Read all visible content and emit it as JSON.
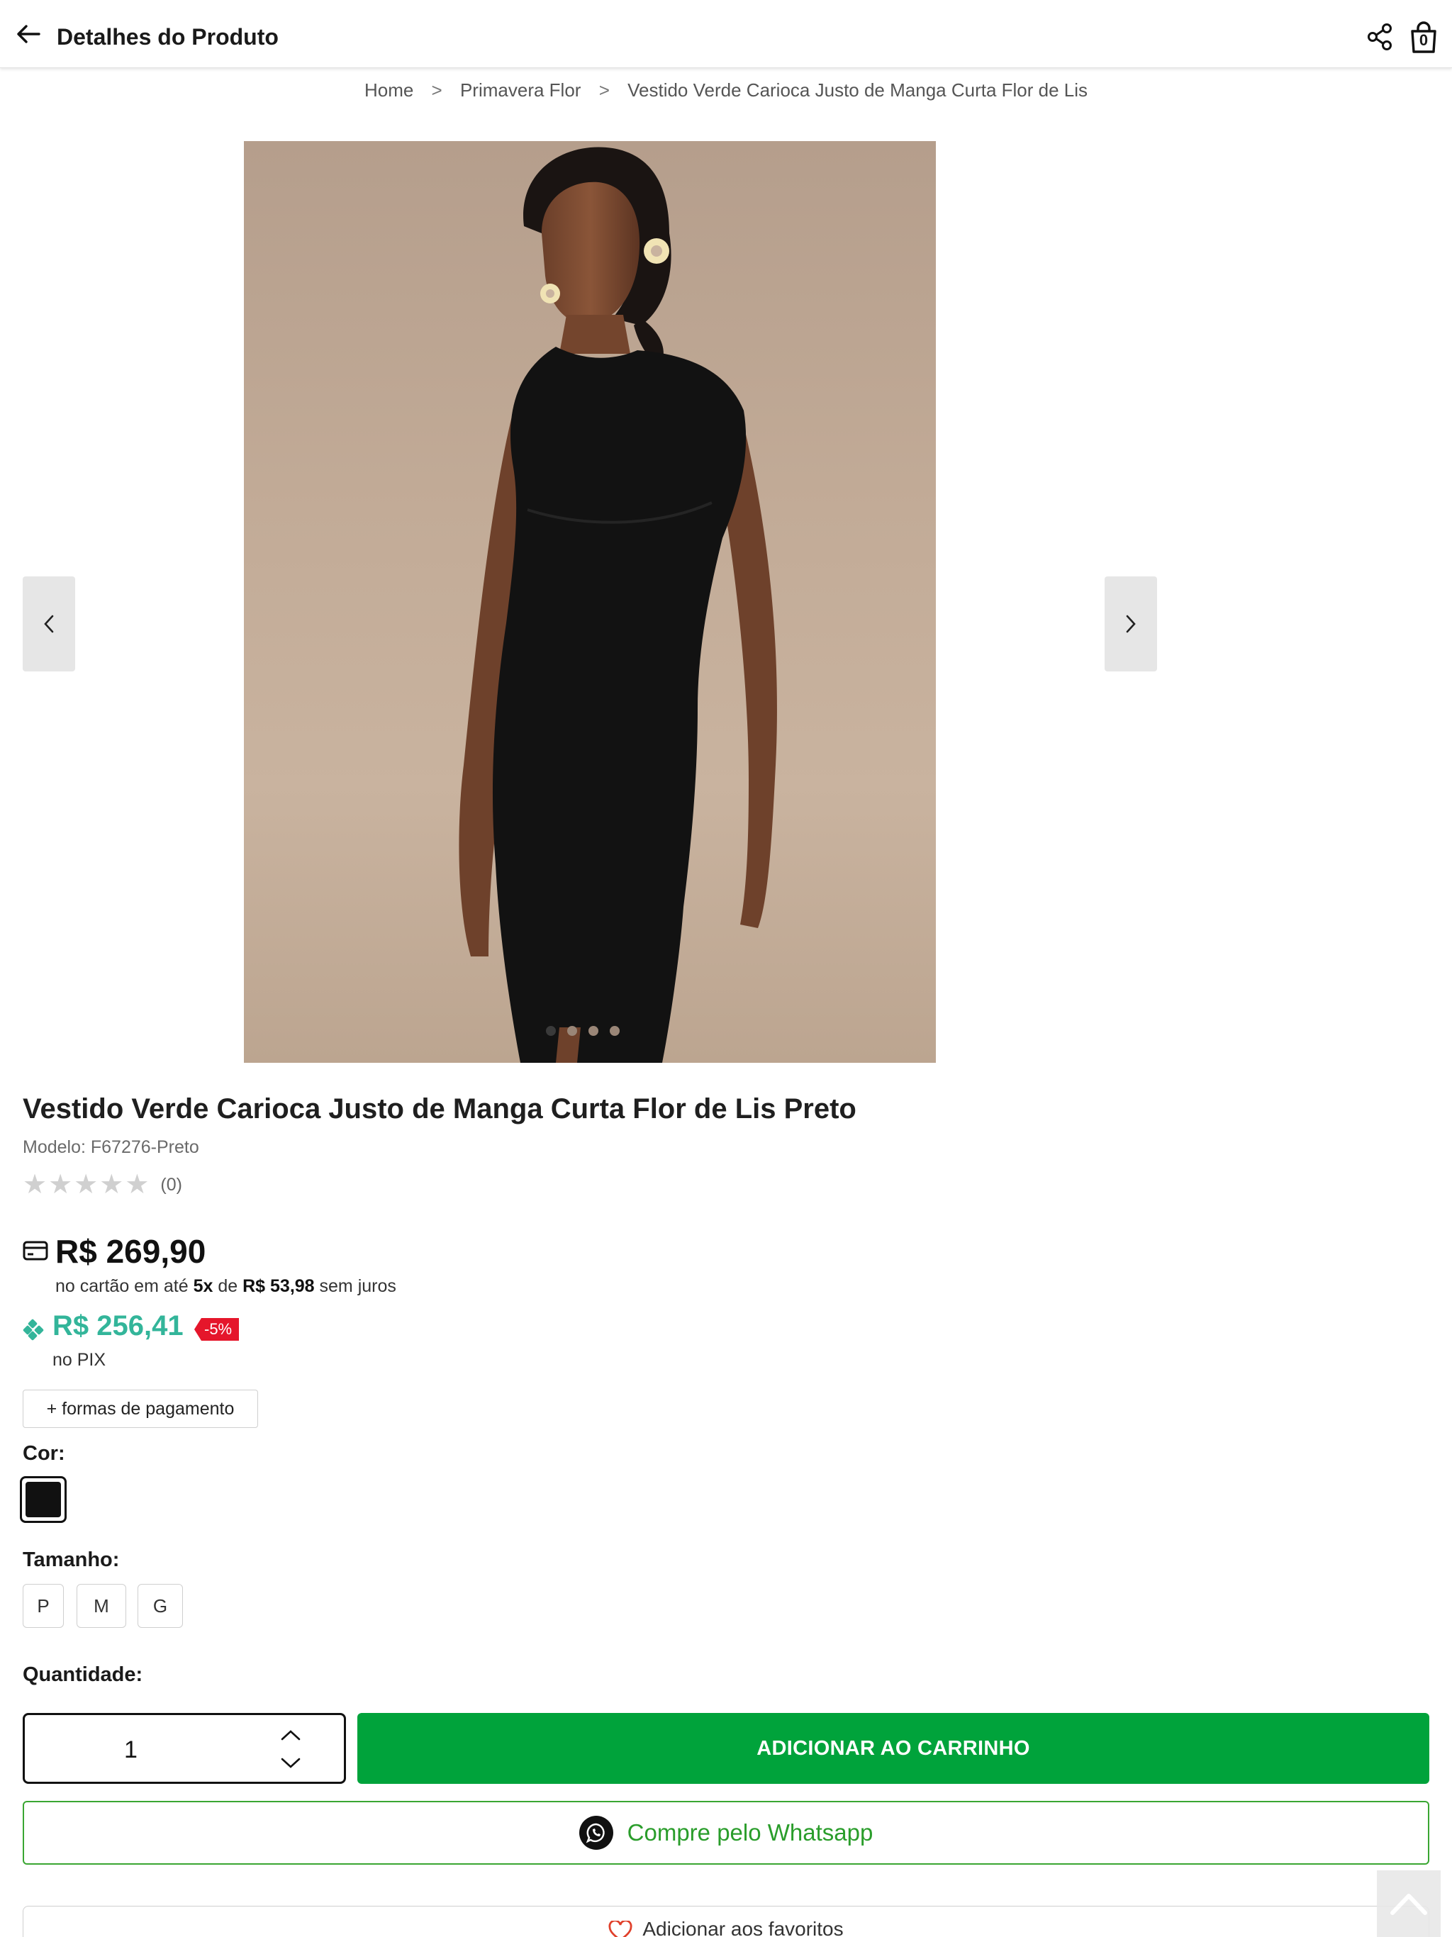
{
  "header": {
    "title": "Detalhes do Produto",
    "cart_count": "0"
  },
  "breadcrumb": {
    "items": [
      "Home",
      "Primavera Flor",
      "Vestido Verde Carioca Justo de Manga Curta Flor de Lis"
    ],
    "separator": ">"
  },
  "gallery": {
    "image_alt": "Modelo usando vestido preto justo de manga curta",
    "slide_count": 4,
    "active_slide": 1
  },
  "product": {
    "title": "Vestido Verde Carioca Justo de Manga Curta Flor de Lis Preto",
    "model": "Modelo: F67276-Preto",
    "rating_stars": 0,
    "review_count": "(0)"
  },
  "pricing": {
    "card_price": "R$ 269,90",
    "installments_prefix": "no cartão em até",
    "installments_count": "5x",
    "installments_mid": "de",
    "installment_value": "R$ 53,98",
    "installments_suffix": "sem juros",
    "pix_price": "R$ 256,41",
    "pix_discount": "-5%",
    "pix_label": "no PIX",
    "payment_methods_button": "+ formas de pagamento"
  },
  "options": {
    "color_label": "Cor:",
    "selected_color": "#111111",
    "size_label": "Tamanho:",
    "sizes": [
      "P",
      "M",
      "G"
    ]
  },
  "purchase": {
    "quantity_label": "Quantidade:",
    "quantity": "1",
    "add_to_cart": "ADICIONAR AO CARRINHO",
    "whatsapp": "Compre pelo Whatsapp",
    "favorites": "Adicionar aos favoritos"
  },
  "colors": {
    "brand_green": "#00a33b",
    "pix_teal": "#33b59a",
    "discount_red": "#e5162b",
    "whatsapp_green": "#2a9d2b"
  },
  "icons": [
    "arrow-left-icon",
    "share-icon",
    "shopping-bag-icon",
    "chevron-left-icon",
    "chevron-right-icon",
    "credit-card-icon",
    "pix-icon",
    "chevron-up-icon",
    "chevron-down-icon",
    "whatsapp-icon",
    "heart-icon",
    "scroll-top-icon"
  ]
}
